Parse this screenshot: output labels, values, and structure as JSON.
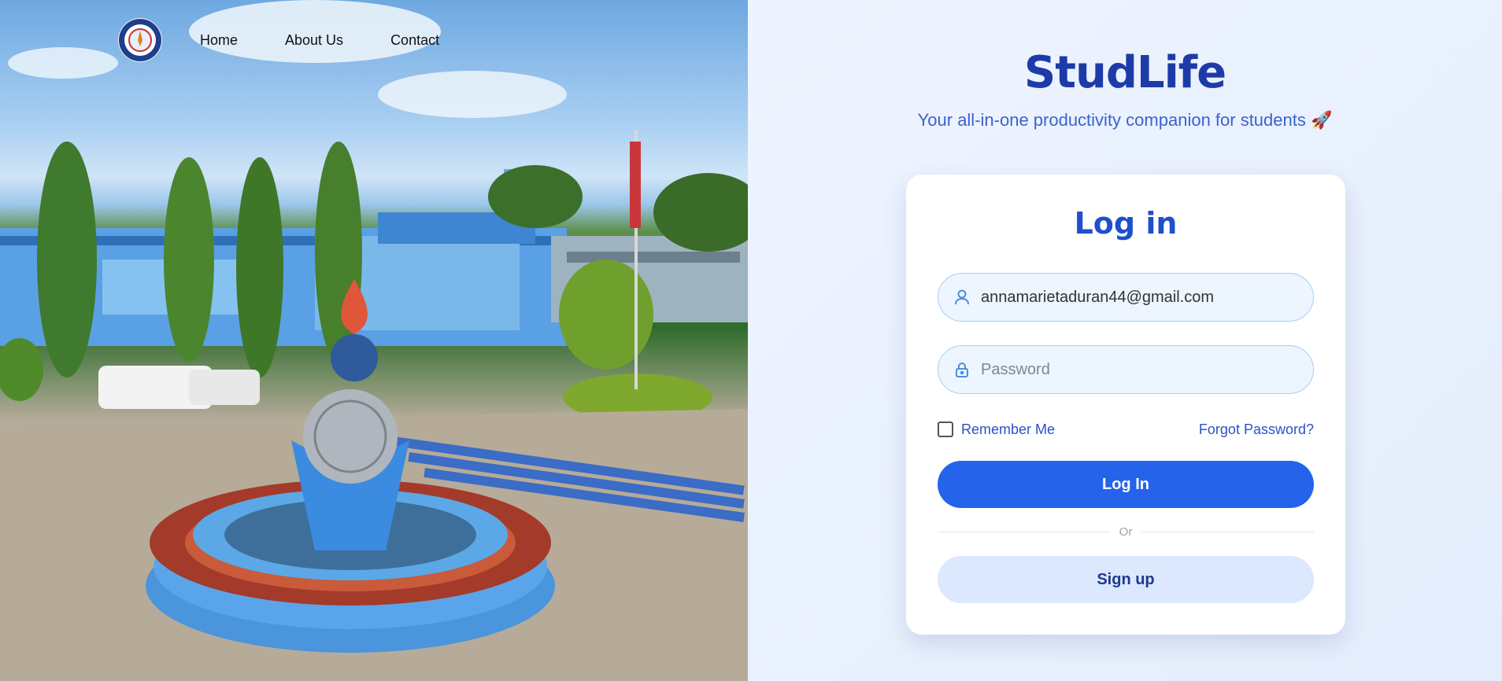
{
  "nav": {
    "logo_icon": "school-seal-icon",
    "links": [
      "Home",
      "About Us",
      "Contact"
    ]
  },
  "hero": {
    "image_description_icon": "campus-photo"
  },
  "brand": {
    "name": "StudLife",
    "tagline": "Your all-in-one productivity companion for students 🚀"
  },
  "login": {
    "title": "Log in",
    "email_value": "annamarietaduran44@gmail.com",
    "email_icon": "user-icon",
    "password_placeholder": "Password",
    "password_icon": "lock-icon",
    "remember_label": "Remember Me",
    "forgot_label": "Forgot Password?",
    "login_button": "Log In",
    "divider_text": "Or",
    "signup_button": "Sign up"
  },
  "colors": {
    "primary": "#2563eb",
    "brand": "#1d3ba8",
    "accent_text": "#2b52c8",
    "secondary_button": "#dbe8fd"
  }
}
